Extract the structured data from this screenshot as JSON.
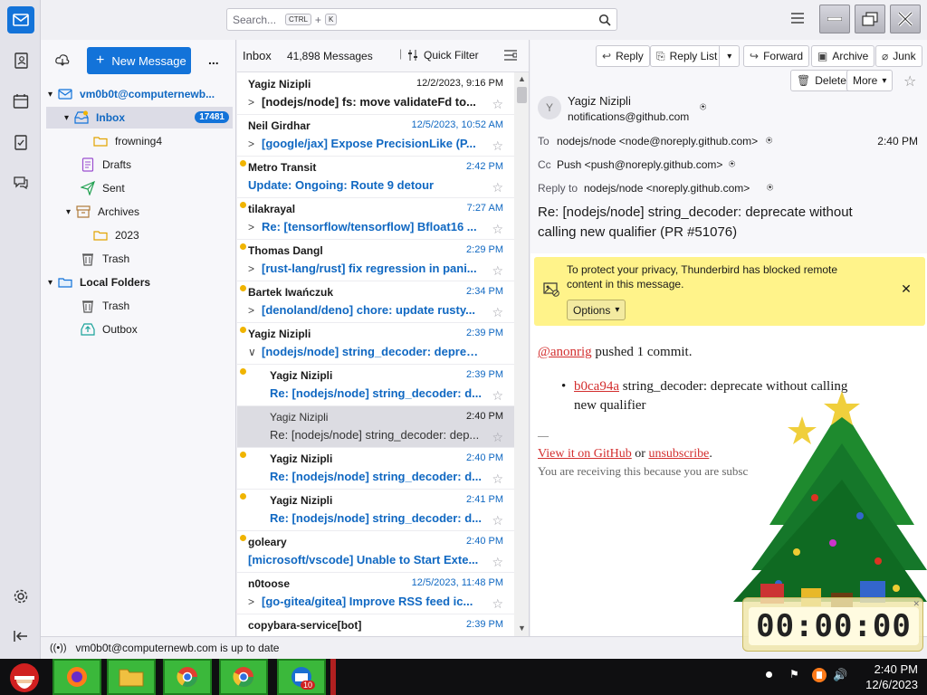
{
  "colors": {
    "accent": "#1373d9",
    "unread": "#1068c2",
    "unread_dot": "#f0b400",
    "notice_bg": "#fff38a",
    "link": "#d32e2e"
  },
  "search": {
    "placeholder": "Search...",
    "key1": "CTRL",
    "plus": "+",
    "key2": "K"
  },
  "folder_pane": {
    "new_message": "New Message",
    "more": "...",
    "account": "vm0b0t@computernewb...",
    "folders": [
      {
        "label": "Inbox",
        "count": "17481",
        "icon": "inbox-icon"
      },
      {
        "label": "frowning4",
        "icon": "folder-icon"
      },
      {
        "label": "Drafts",
        "icon": "drafts-icon"
      },
      {
        "label": "Sent",
        "icon": "sent-icon"
      },
      {
        "label": "Archives",
        "icon": "archive-icon"
      },
      {
        "label": "2023",
        "icon": "folder-icon"
      },
      {
        "label": "Trash",
        "icon": "trash-icon"
      }
    ],
    "local_folders": "Local Folders",
    "local": [
      {
        "label": "Trash",
        "icon": "trash-icon"
      },
      {
        "label": "Outbox",
        "icon": "outbox-icon"
      }
    ]
  },
  "message_list": {
    "title": "Inbox",
    "count": "41,898 Messages",
    "quick_filter": "Quick Filter",
    "messages": [
      {
        "sender": "Yagiz Nizipli",
        "date": "12/2/2023, 9:16 PM",
        "subject": "[nodejs/node] fs: move validateFd to..."
      },
      {
        "sender": "Neil Girdhar",
        "date": "12/5/2023, 10:52 AM",
        "subject": "[google/jax] Expose PrecisionLike (P..."
      },
      {
        "sender": "Metro Transit",
        "date": "2:42 PM",
        "subject": "Update: Ongoing: Route 9 detour"
      },
      {
        "sender": "tilakrayal",
        "date": "7:27 AM",
        "subject": "Re: [tensorflow/tensorflow] Bfloat16 ..."
      },
      {
        "sender": "Thomas Dangl",
        "date": "2:29 PM",
        "subject": "[rust-lang/rust] fix regression in pani..."
      },
      {
        "sender": "Bartek Iwańczuk",
        "date": "2:34 PM",
        "subject": "[denoland/deno] chore: update rusty..."
      },
      {
        "sender": "Yagiz Nizipli",
        "date": "2:39 PM",
        "subject": "[nodejs/node] string_decoder: deprec..."
      },
      {
        "sender": "Yagiz Nizipli",
        "date": "2:39 PM",
        "subject": "Re: [nodejs/node] string_decoder: d..."
      },
      {
        "sender": "Yagiz Nizipli",
        "date": "2:40 PM",
        "subject": "Re: [nodejs/node] string_decoder: dep..."
      },
      {
        "sender": "Yagiz Nizipli",
        "date": "2:40 PM",
        "subject": "Re: [nodejs/node] string_decoder: d..."
      },
      {
        "sender": "Yagiz Nizipli",
        "date": "2:41 PM",
        "subject": "Re: [nodejs/node] string_decoder: d..."
      },
      {
        "sender": "goleary",
        "date": "2:40 PM",
        "subject": "[microsoft/vscode] Unable to Start Exte..."
      },
      {
        "sender": "n0toose",
        "date": "12/5/2023, 11:48 PM",
        "subject": "[go-gitea/gitea] Improve RSS feed ic..."
      },
      {
        "sender": "copybara-service[bot]",
        "date": "2:39 PM",
        "subject": ""
      }
    ]
  },
  "message_pane": {
    "toolbar": {
      "reply": "Reply",
      "reply_list": "Reply List",
      "forward": "Forward",
      "archive": "Archive",
      "junk": "Junk",
      "delete": "Delete",
      "more": "More"
    },
    "avatar_letter": "Y",
    "from_name": "Yagiz Nizipli",
    "from_email": "notifications@github.com",
    "to_label": "To",
    "to": "nodejs/node <node@noreply.github.com>",
    "time": "2:40 PM",
    "cc_label": "Cc",
    "cc": "Push <push@noreply.github.com>",
    "reply_to_label": "Reply to",
    "reply_to": "nodejs/node <noreply.github.com>",
    "subject_line1": "Re: [nodejs/node] string_decoder: deprecate without",
    "subject_line2": "calling new qualifier (PR #51076)",
    "notice_line1": "To protect your privacy, Thunderbird has blocked remote",
    "notice_line2": "content in this message.",
    "options": "Options",
    "body": {
      "mention": "@anonrig",
      "pushed": " pushed 1 commit.",
      "commit": "b0ca94a",
      "commit_msg_line1": " string_decoder: deprecate without calling",
      "commit_msg_line2": "new qualifier",
      "dash": "—",
      "view": "View it on GitHub",
      "or": " or ",
      "unsub": "unsubscribe",
      "period": ".",
      "receiving": "You are receiving this because you are subsc"
    }
  },
  "status": "vm0b0t@computernewb.com is up to date",
  "taskbar": {
    "time": "2:40 PM",
    "date": "12/6/2023",
    "badge": "10"
  },
  "countdown": "00:00:00"
}
